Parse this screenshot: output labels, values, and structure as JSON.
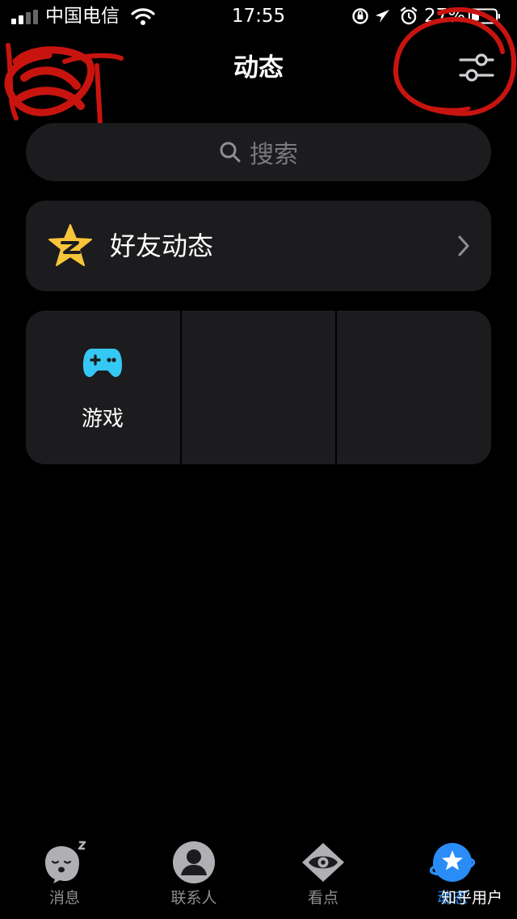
{
  "status_bar": {
    "carrier": "中国电信",
    "time": "17:55",
    "battery": "27%"
  },
  "nav": {
    "title": "动态",
    "filter_icon": "sliders-icon"
  },
  "search": {
    "placeholder": "搜索",
    "icon": "search-icon"
  },
  "friends_feed": {
    "label": "好友动态",
    "icon": "qzone-star-icon"
  },
  "grid": {
    "game_label": "游戏",
    "game_icon": "gamepad-icon"
  },
  "tabs": [
    {
      "label": "消息",
      "icon": "sleeping-penguin-icon"
    },
    {
      "label": "联系人",
      "icon": "contact-person-icon"
    },
    {
      "label": "看点",
      "icon": "eye-icon"
    },
    {
      "label": "动态",
      "icon": "star-planet-icon",
      "active": true
    }
  ],
  "watermark": "知乎用户",
  "colors": {
    "background": "#000000",
    "card": "#1c1c1e",
    "accent_blue": "#2a8cf7",
    "game_icon": "#36c8f4",
    "star_yellow": "#f7c53a",
    "annotation_red": "#c8140f"
  }
}
